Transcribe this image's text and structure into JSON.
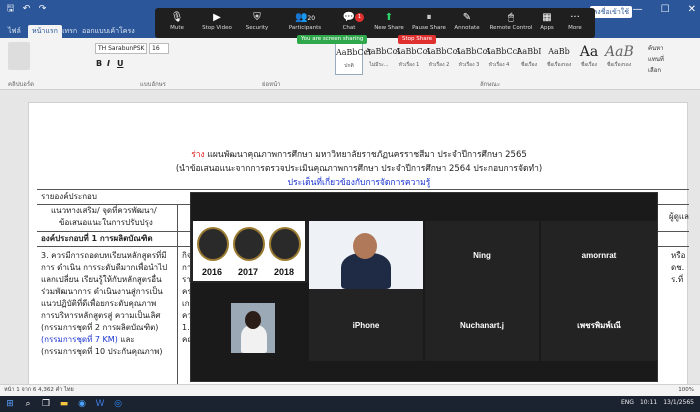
{
  "titlebar": {
    "qat_save": "🖫",
    "qat_undo": "↶",
    "qat_redo": "↷",
    "user": "ลงชื่อเข้าใช้",
    "minimize": "—",
    "maximize": "☐",
    "close": "✕"
  },
  "ribbon_tabs": [
    "ไฟล์",
    "หน้าแรก",
    "แทรก",
    "ออกแบบ",
    "เค้าโครง"
  ],
  "ribbon": {
    "font_name": "TH SarabunPSK",
    "font_size": "16",
    "clipboard_label": "คลิปบอร์ด",
    "font_label": "แบบอักษร",
    "paragraph_label": "ย่อหน้า",
    "styles_label": "ลักษณะ",
    "editing_find": "ค้นหา",
    "editing_replace": "แทนที่",
    "editing_select": "เลือก",
    "bold": "B",
    "italic": "I",
    "underline": "U",
    "styles": [
      {
        "preview": "AaBbCcI",
        "name": "ปกติ"
      },
      {
        "preview": "AaBbCcI",
        "name": "ไม่มีระ..."
      },
      {
        "preview": "AaBbCcI",
        "name": "หัวเรื่อง 1"
      },
      {
        "preview": "AaBbCcI",
        "name": "หัวเรื่อง 2"
      },
      {
        "preview": "AaBbCcI",
        "name": "หัวเรื่อง 3"
      },
      {
        "preview": "AaBbCcI",
        "name": "หัวเรื่อง 4"
      },
      {
        "preview": "AaBbI",
        "name": "ชื่อเรื่อง"
      },
      {
        "preview": "AaBb",
        "name": "ชื่อเรื่องรอง"
      },
      {
        "preview": "Aa",
        "name": "ชื่อเรื่อง"
      },
      {
        "preview": "AaB",
        "name": "ชื่อเรื่องรอง"
      }
    ]
  },
  "zoom_toolbar": {
    "mute": "Mute",
    "stop_video": "Stop Video",
    "security": "Security",
    "participants": "Participants",
    "participants_count": "20",
    "chat": "Chat",
    "chat_badge": "1",
    "new_share": "New Share",
    "pause_share": "Pause Share",
    "annotate": "Annotate",
    "remote_control": "Remote Control",
    "apps": "Apps",
    "more": "More",
    "sharing_status": "You are screen sharing",
    "stop_share": "Stop Share"
  },
  "document": {
    "heading1_draft": "ร่าง",
    "heading1": "แผนพัฒนาคุณภาพการศึกษา มหาวิทยาลัยราชภัฏนครราชสีมา ประจำปีการศึกษา 2565",
    "heading2": "(นำข้อเสนอแนะจากการตรวจประเมินคุณภาพการศึกษา ประจำปีการศึกษา 2564 ประกอบการจัดทำ)",
    "heading3": "ประเด็นที่เกี่ยวข้องกับการจัดการความรู้",
    "row_component": "รายองค์ประกอบ",
    "col_header1_line1": "แนวทางเสริม/ จุดที่ควรพัฒนา/",
    "col_header1_line2": "ข้อเสนอแนะในการปรับปรุง",
    "col_header_right": "ผู้ดูแล",
    "component1": "องค์ประกอบที่ 1 การผลิตบัณฑิต",
    "item3_lines": [
      "3. ควรมีการถอดบทเรียนหลักสูตรที่มี",
      "การ ดำเนิน การระดับดีมากเพื่อนำไป",
      "แลกเปลี่ยน เรียนรู้ให้กับหลักสูตรอื่น",
      "ร่วมพัฒนาการ ดำเนินงานสู่การเป็น",
      "แนวปฏิบัติที่ดีเพื่อยกระดับคุณภาพ",
      "การบริหารหลักสูตรสู่ ความเป็นเลิศ",
      "(กรรมการชุดที่ 2 การผลิตบัณฑิต)"
    ],
    "item3_blue": "(กรรมการชุดที่ 7 KM)",
    "item3_and": "และ",
    "item3_last": "(กรรมการชุดที่ 10 ประกันคุณภาพ)",
    "col2_frag": [
      "กิจ",
      "กา",
      "ราะ",
      "ครว",
      "เกณ",
      "ควร",
      "1.",
      "คณ"
    ],
    "right_frag": [
      "หรือ",
      "ดช.",
      "ร.ที่"
    ]
  },
  "gallery": {
    "years": [
      "2016",
      "2017",
      "2018"
    ],
    "names": [
      "Ning",
      "amornrat",
      "iPhone",
      "Nuchanart.j",
      "เพชรพิมพ์เณี"
    ]
  },
  "statusbar": {
    "page": "หน้า 1 จาก 6",
    "words": "4,362 คำ",
    "lang": "ไทย",
    "zoom": "100%"
  },
  "taskbar": {
    "time": "10:11",
    "lang": "ENG",
    "date": "13/1/2565"
  }
}
